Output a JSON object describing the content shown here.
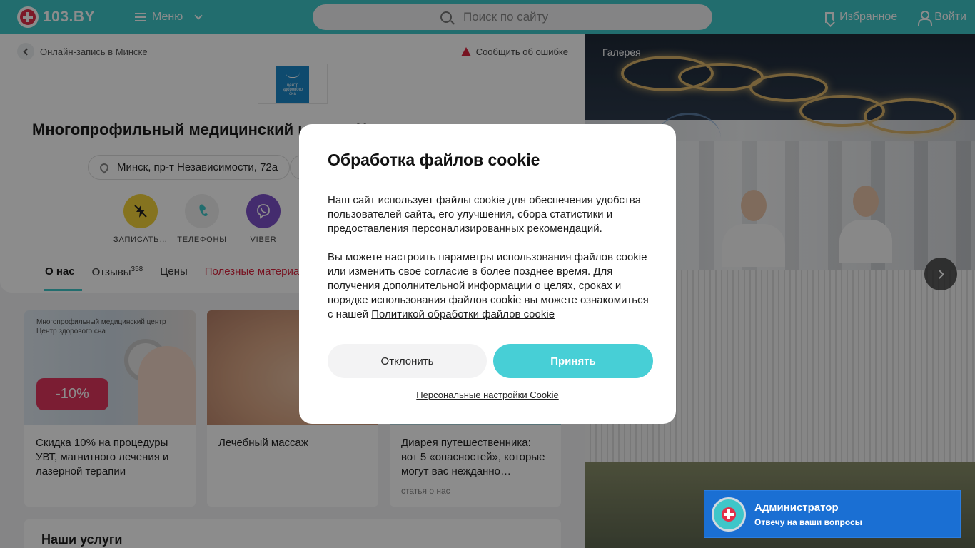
{
  "header": {
    "logo_text": "103.BY",
    "menu_label": "Меню",
    "search_placeholder": "Поиск по сайту",
    "favorites_label": "Избранное",
    "login_label": "Войти"
  },
  "breadcrumb": {
    "label": "Онлайн-запись в Минске"
  },
  "report_error": "Сообщить об ошибке",
  "clinic": {
    "logo_text": "центр здорового сна",
    "title": "Многопрофильный медицинский центр «Ц",
    "address": "Минск, пр-т Независимости, 72а"
  },
  "actions": [
    {
      "label": "ЗАПИСАТЬ…",
      "icon": "flash-off-icon",
      "color": "#f2d139"
    },
    {
      "label": "ТЕЛЕФОНЫ",
      "icon": "phone-icon",
      "color": "#eeeeee"
    },
    {
      "label": "VIBER",
      "icon": "viber-icon",
      "color": "#7c50c8"
    }
  ],
  "tabs": {
    "about": "О нас",
    "reviews": "Отзывы",
    "reviews_count": "358",
    "prices": "Цены",
    "useful": "Полезные материалы"
  },
  "promos": [
    {
      "caption": "Многопрофильный медицинский центр Центр здорового сна",
      "badge": "-10%",
      "text": "Скидка 10% на процедуры УВТ, магнитного лечения и лазерной терапии"
    },
    {
      "text": "Лечебный массаж"
    },
    {
      "text": "Диарея путешественника: вот 5 «опасностей», которые могут вас нежданно…",
      "sub": "статья о нас"
    }
  ],
  "services_title": "Наши услуги",
  "gallery": {
    "label": "Галерея"
  },
  "chat": {
    "title": "Администратор",
    "subtitle": "Отвечу на ваши вопросы"
  },
  "cookie_modal": {
    "title": "Обработка файлов cookie",
    "paragraph1": "Наш сайт использует файлы cookie для обеспечения удобства пользователей сайта, его улучшения, сбора статистики и предоставления персонализированных рекомендаций.",
    "paragraph2": "Вы можете настроить параметры использования файлов cookie или изменить свое согласие в более позднее время. Для получения дополнительной информации о целях, сроках и порядке использования файлов cookie вы можете ознакомиться с нашей ",
    "policy_link": "Политикой обработки файлов cookie",
    "decline": "Отклонить",
    "accept": "Принять",
    "settings": "Персональные настройки Cookie"
  },
  "colors": {
    "brand": "#3ec6c9",
    "accent": "#47cfd6",
    "red": "#d9233d"
  }
}
